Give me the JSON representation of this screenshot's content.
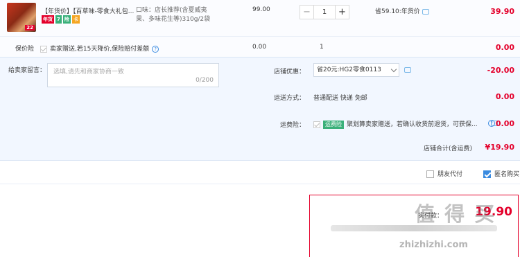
{
  "item": {
    "thumb_badge": "22",
    "title": "【年货价】【百草味-零食大礼包...",
    "badges": [
      {
        "text": "年货",
        "color": "#e4002b"
      },
      {
        "text": "7",
        "color": "#3ab07a"
      },
      {
        "text": "险",
        "color": "#3ab07a"
      },
      {
        "text": "卡",
        "color": "#f5a623"
      }
    ],
    "sku": "口味：店长推荐(含夏威夷果、多味花生等)310g/2袋",
    "unit_price": "99.00",
    "qty_minus": "−",
    "quantity": "1",
    "qty_plus": "+",
    "discount": "省59.10:年货价",
    "subtotal": "39.90"
  },
  "insurance": {
    "label": "保价险",
    "desc": "卖家赠送,若15天降价,保险赔付差额",
    "help": "?",
    "price": "0.00",
    "qty": "1",
    "subtotal": "0.00"
  },
  "memo": {
    "label": "给卖家留言：",
    "placeholder": "选填,请先和商家协商一致",
    "count": "0/200"
  },
  "shop_promo": {
    "label": "店铺优惠：",
    "selected": "省20元:HG2零食0113",
    "amount": "-20.00"
  },
  "shipping": {
    "label": "运送方式：",
    "value": "普通配送 快递 免邮",
    "amount": "0.00"
  },
  "return_ins": {
    "label": "运费险：",
    "badge": "运费险",
    "desc": "聚划算卖家赠送，若确认收货前退货，可获保...",
    "amount": "0.00"
  },
  "shop_total": {
    "label": "店铺合计(含运费)",
    "value": "¥19.90"
  },
  "options": {
    "friend_pay": "朋友代付",
    "anonymous": "匿名购买"
  },
  "pay_box": {
    "label": "实付款：",
    "amount": "19.90"
  },
  "watermark": {
    "cn": "值 得 买",
    "url": "zhizhizhi.com"
  },
  "colors": {
    "accent": "#e4002b",
    "link_blue": "#3a8be0",
    "panel_bg": "#f2f7ff"
  }
}
